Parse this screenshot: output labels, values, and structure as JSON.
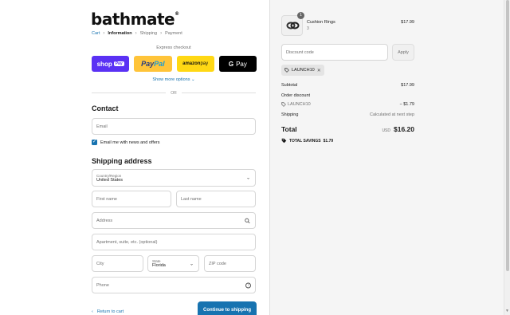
{
  "brand": {
    "logo_text": "bathmate",
    "logo_mark": "®"
  },
  "breadcrumb": {
    "cart": "Cart",
    "information": "Information",
    "shipping": "Shipping",
    "payment": "Payment"
  },
  "express": {
    "title": "Express checkout",
    "shop_pay": "shop",
    "shop_pay_badge": "Pay",
    "paypal_a": "Pay",
    "paypal_b": "Pal",
    "amazon_a": "amazon",
    "amazon_b": " pay",
    "gpay_g": "G",
    "gpay": "Pay",
    "show_more": "Show more options ⌄",
    "or": "OR"
  },
  "contact": {
    "heading": "Contact",
    "email_placeholder": "Email",
    "newsletter_label": "Email me with news and offers",
    "newsletter_checked": true
  },
  "shipping": {
    "heading": "Shipping address",
    "country_label": "Country/Region",
    "country_value": "United States",
    "first_name_placeholder": "First name",
    "last_name_placeholder": "Last name",
    "address_placeholder": "Address",
    "apartment_placeholder": "Apartment, suite, etc. (optional)",
    "city_placeholder": "City",
    "state_label": "State",
    "state_value": "Florida",
    "zip_placeholder": "ZIP code",
    "phone_placeholder": "Phone"
  },
  "actions": {
    "return_label": "Return to cart",
    "continue_label": "Continue to shipping"
  },
  "order": {
    "item": {
      "name": "Cushion Rings",
      "variant": "3",
      "quantity": "1",
      "price": "$17.99"
    },
    "discount_placeholder": "Discount code",
    "apply_label": "Apply",
    "applied_code": "LAUNCH10",
    "subtotal_label": "Subtotal",
    "subtotal_value": "$17.99",
    "order_discount_label": "Order discount",
    "discount_code": "LAUNCH10",
    "discount_value": "− $1.79",
    "shipping_label": "Shipping",
    "shipping_value": "Calculated at next step",
    "total_label": "Total",
    "currency": "USD",
    "total_value": "$16.20",
    "savings_label": "TOTAL SAVINGS",
    "savings_value": "$1.79"
  },
  "colors": {
    "accent": "#1773b0",
    "shop_pay": "#5a31f4",
    "paypal": "#ffc439",
    "amazon": "#ffd814",
    "gpay": "#000000"
  }
}
